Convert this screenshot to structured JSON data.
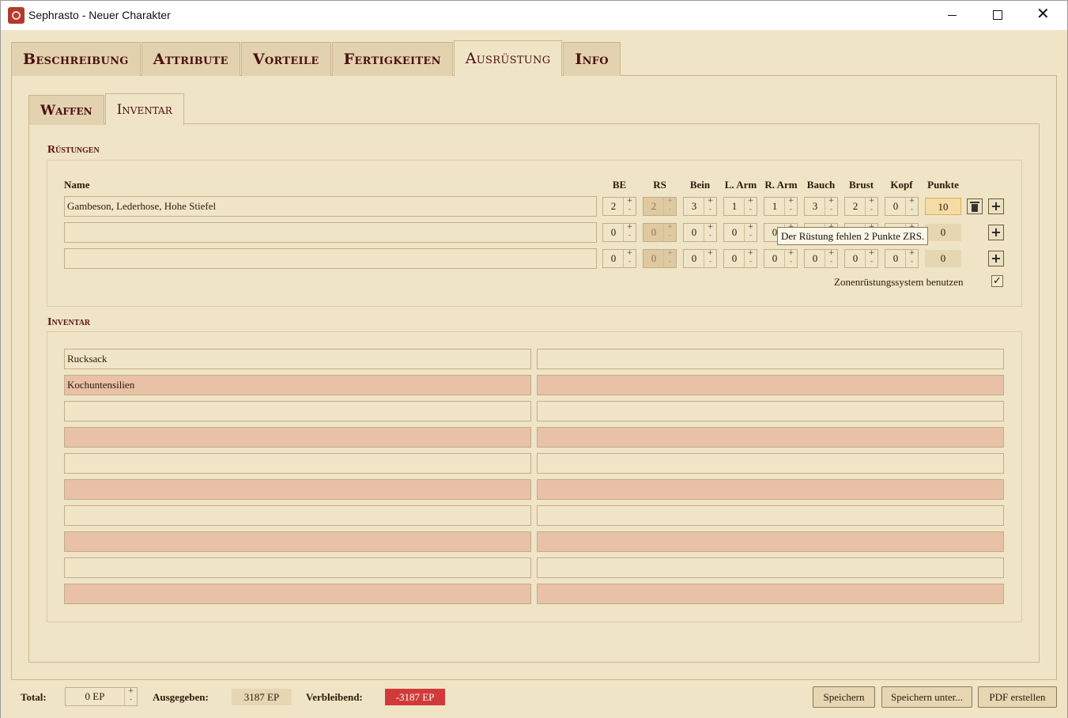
{
  "window": {
    "title": "Sephrasto - Neuer Charakter"
  },
  "tabs": [
    "Beschreibung",
    "Attribute",
    "Vorteile",
    "Fertigkeiten",
    "Ausrüstung",
    "Info"
  ],
  "active_tab": "Ausrüstung",
  "subtabs": [
    "Waffen",
    "Inventar"
  ],
  "active_subtab": "Inventar",
  "ruestungen": {
    "title": "Rüstungen",
    "headers": {
      "name": "Name",
      "be": "BE",
      "rs": "RS",
      "bein": "Bein",
      "larm": "L. Arm",
      "rarm": "R. Arm",
      "bauch": "Bauch",
      "brust": "Brust",
      "kopf": "Kopf",
      "punkte": "Punkte"
    },
    "rows": [
      {
        "name": "Gambeson, Lederhose, Hohe Stiefel",
        "be": "2",
        "rs": "2",
        "bein": "3",
        "larm": "1",
        "rarm": "1",
        "bauch": "3",
        "brust": "2",
        "kopf": "0",
        "punkte": "10"
      },
      {
        "name": "",
        "be": "0",
        "rs": "0",
        "bein": "0",
        "larm": "0",
        "rarm": "0",
        "bauch": "0",
        "brust": "0",
        "kopf": "0",
        "punkte": "0"
      },
      {
        "name": "",
        "be": "0",
        "rs": "0",
        "bein": "0",
        "larm": "0",
        "rarm": "0",
        "bauch": "0",
        "brust": "0",
        "kopf": "0",
        "punkte": "0"
      }
    ],
    "tooltip": "Der Rüstung fehlen 2 Punkte ZRS.",
    "zrs_label": "Zonenrüstungssystem benutzen",
    "zrs_checked": true,
    "check_glyph": "✓"
  },
  "inventar": {
    "title": "Inventar",
    "left": [
      "Rucksack",
      "Kochuntensilien",
      "",
      "",
      "",
      "",
      "",
      "",
      "",
      ""
    ],
    "right": [
      "",
      "",
      "",
      "",
      "",
      "",
      "",
      "",
      "",
      ""
    ]
  },
  "footer": {
    "total_label": "Total:",
    "total_value": "0 EP",
    "ausgegeben_label": "Ausgegeben:",
    "ausgegeben_value": "3187 EP",
    "verbleibend_label": "Verbleibend:",
    "verbleibend_value": "-3187 EP",
    "buttons": [
      "Speichern",
      "Speichern unter...",
      "PDF erstellen"
    ]
  },
  "colors": {
    "background": "#f0e4c6",
    "tab_text": "#4a0f0f",
    "row_rose": "#e8c1a6",
    "verbleibend_bg": "#d23a3a",
    "ausgegeben_bg": "#e6d7b3"
  },
  "glyphs": {
    "plus": "+",
    "minus": "-",
    "add": "+"
  }
}
